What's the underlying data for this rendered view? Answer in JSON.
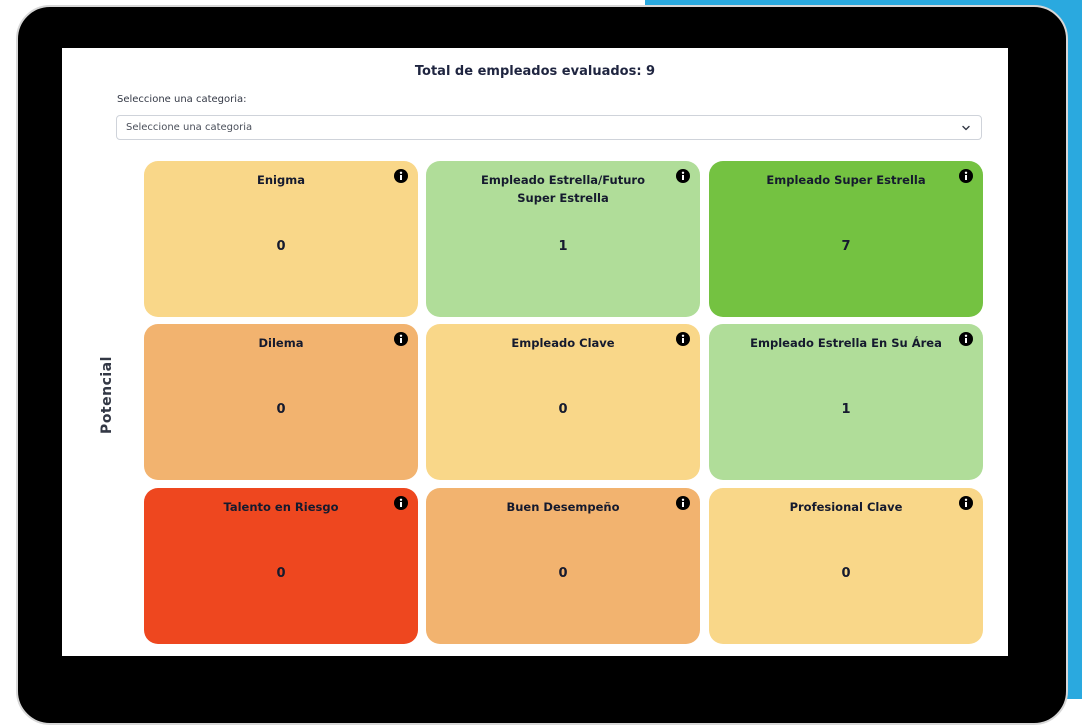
{
  "header": {
    "total_label": "Total de empleados evaluados: 9"
  },
  "filter": {
    "label": "Seleccione una categoria:",
    "selected": "Seleccione una categoria"
  },
  "axis": {
    "y_label": "Potencial"
  },
  "colors": {
    "accent": "#2aa9df",
    "pale_yellow": "#f9d789",
    "light_orange": "#f2b36f",
    "light_green": "#b0dd99",
    "green": "#74c241",
    "red": "#ee471f"
  },
  "grid": {
    "cells": [
      {
        "title": "Enigma",
        "count": "0",
        "color": "#f9d789",
        "icon": "info-icon"
      },
      {
        "title": "Empleado Estrella/Futuro Super Estrella",
        "count": "1",
        "color": "#b0dd99",
        "icon": "info-icon"
      },
      {
        "title": "Empleado Super Estrella",
        "count": "7",
        "color": "#74c241",
        "icon": "info-icon"
      },
      {
        "title": "Dilema",
        "count": "0",
        "color": "#f2b36f",
        "icon": "info-icon"
      },
      {
        "title": "Empleado Clave",
        "count": "0",
        "color": "#f9d789",
        "icon": "info-icon"
      },
      {
        "title": "Empleado Estrella En Su Área",
        "count": "1",
        "color": "#b0dd99",
        "icon": "info-icon"
      },
      {
        "title": "Talento en Riesgo",
        "count": "0",
        "color": "#ee471f",
        "icon": "info-icon"
      },
      {
        "title": "Buen Desempeño",
        "count": "0",
        "color": "#f2b36f",
        "icon": "info-icon"
      },
      {
        "title": "Profesional Clave",
        "count": "0",
        "color": "#f9d789",
        "icon": "info-icon"
      }
    ]
  }
}
